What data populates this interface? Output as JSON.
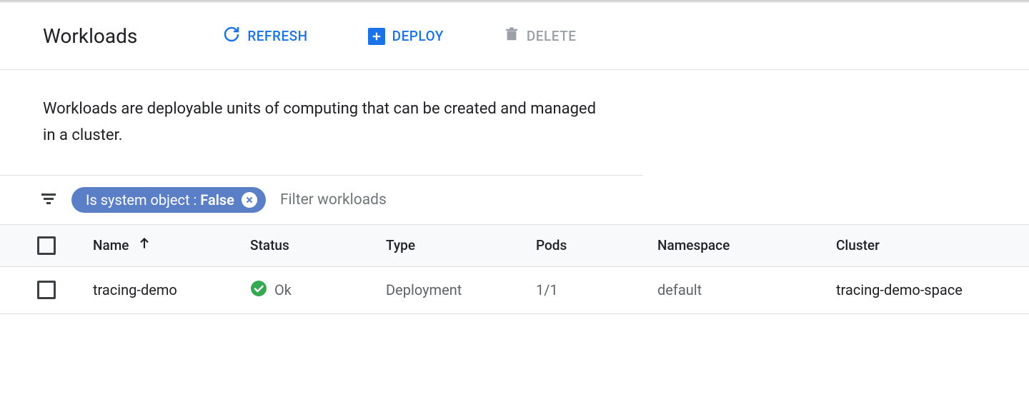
{
  "header": {
    "title": "Workloads",
    "refresh_label": "Refresh",
    "deploy_label": "Deploy",
    "delete_label": "Delete"
  },
  "description": "Workloads are deployable units of computing that can be created and managed in a cluster.",
  "filter": {
    "chip_prefix": "Is system object : ",
    "chip_value": "False",
    "placeholder": "Filter workloads"
  },
  "table": {
    "columns": {
      "name": "Name",
      "status": "Status",
      "type": "Type",
      "pods": "Pods",
      "namespace": "Namespace",
      "cluster": "Cluster"
    },
    "rows": [
      {
        "name": "tracing-demo",
        "status": "Ok",
        "type": "Deployment",
        "pods": "1/1",
        "namespace": "default",
        "cluster": "tracing-demo-space"
      }
    ]
  }
}
